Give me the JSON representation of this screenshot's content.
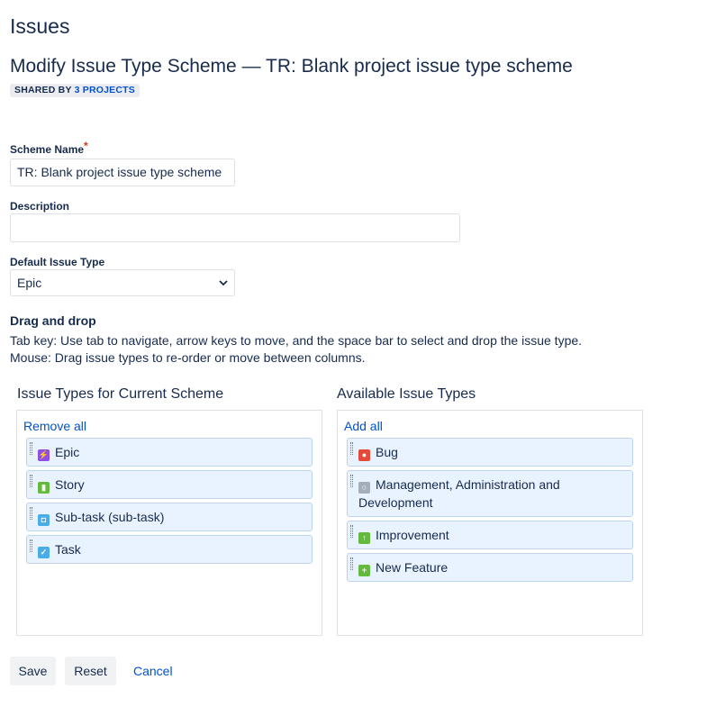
{
  "page_title": "Issues",
  "heading": "Modify Issue Type Scheme — TR: Blank project issue type scheme",
  "badge": {
    "prefix": "SHARED BY",
    "link": "3 PROJECTS"
  },
  "form": {
    "scheme_name_label": "Scheme Name",
    "required_mark": "*",
    "scheme_name_value": "TR: Blank project issue type scheme",
    "description_label": "Description",
    "description_value": "",
    "default_label": "Default Issue Type",
    "default_value": "Epic"
  },
  "help": {
    "title": "Drag and drop",
    "line1": "Tab key: Use tab to navigate, arrow keys to move, and the space bar to select and drop the issue type.",
    "line2": "Mouse: Drag issue types to re-order or move between columns."
  },
  "current": {
    "title": "Issue Types for Current Scheme",
    "action": "Remove all",
    "items": [
      {
        "label": "Epic",
        "icon": "epic-icon",
        "color": "#904ee2"
      },
      {
        "label": "Story",
        "icon": "story-icon",
        "color": "#63ba3c"
      },
      {
        "label": "Sub-task (sub-task)",
        "icon": "subtask-icon",
        "color": "#4bade8"
      },
      {
        "label": "Task",
        "icon": "task-icon",
        "color": "#4bade8"
      }
    ]
  },
  "available": {
    "title": "Available Issue Types",
    "action": "Add all",
    "items": [
      {
        "label": "Bug",
        "icon": "bug-icon",
        "color": "#e5493a"
      },
      {
        "label": "Management, Administration and Development",
        "icon": "generic-icon",
        "color": "#a5adba"
      },
      {
        "label": "Improvement",
        "icon": "improvement-icon",
        "color": "#63ba3c"
      },
      {
        "label": "New Feature",
        "icon": "new-feature-icon",
        "color": "#63ba3c"
      }
    ]
  },
  "buttons": {
    "save": "Save",
    "reset": "Reset",
    "cancel": "Cancel"
  }
}
